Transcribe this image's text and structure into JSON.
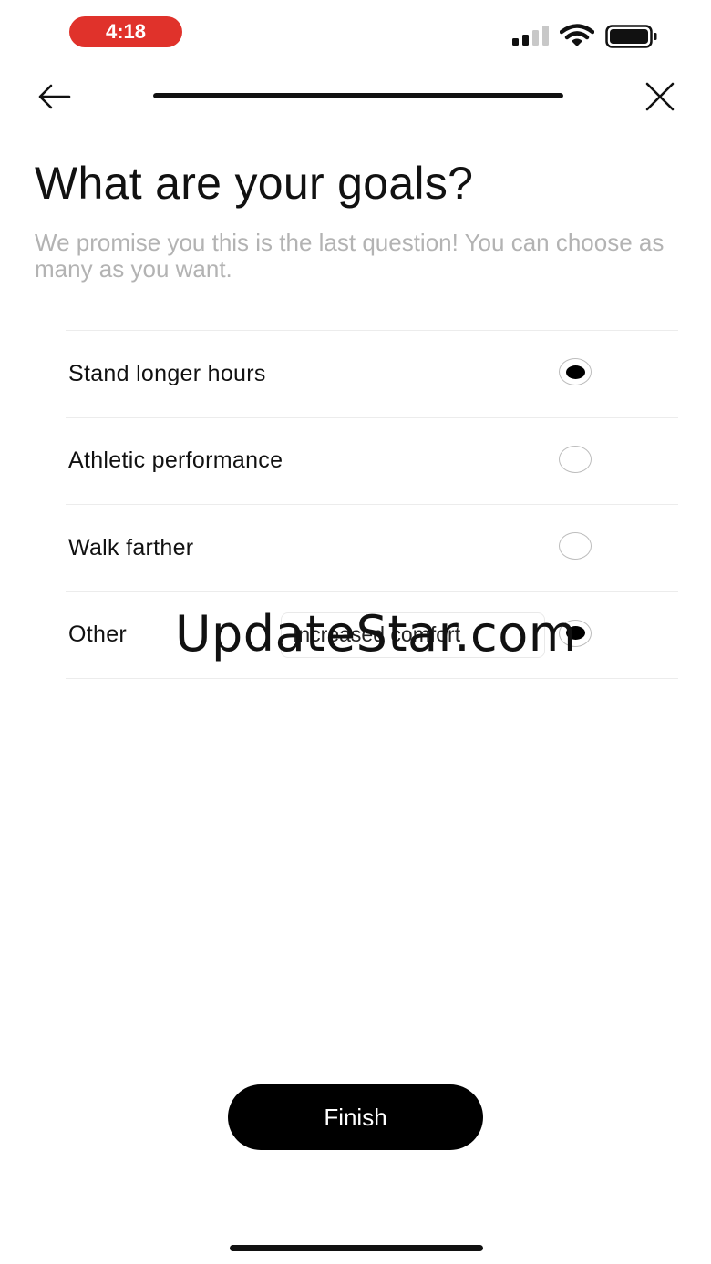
{
  "status_bar": {
    "time": "4:18",
    "time_pill_color": "#e0322b",
    "signal_icon": "cellular-signal-icon",
    "wifi_icon": "wifi-icon",
    "battery_icon": "battery-icon"
  },
  "nav": {
    "back_icon": "arrow-left-icon",
    "close_icon": "close-icon",
    "progress_percent": 100
  },
  "title": "What are your goals?",
  "subtitle": "We promise you this is the last question! You can choose as many as you want.",
  "options": [
    {
      "label": "Stand longer hours",
      "selected": true
    },
    {
      "label": "Athletic performance",
      "selected": false
    },
    {
      "label": "Walk farther",
      "selected": false
    },
    {
      "label": "Other",
      "selected": true,
      "input_value": "Increased comfort"
    }
  ],
  "watermark": "UpdateStar.com",
  "finish_label": "Finish"
}
